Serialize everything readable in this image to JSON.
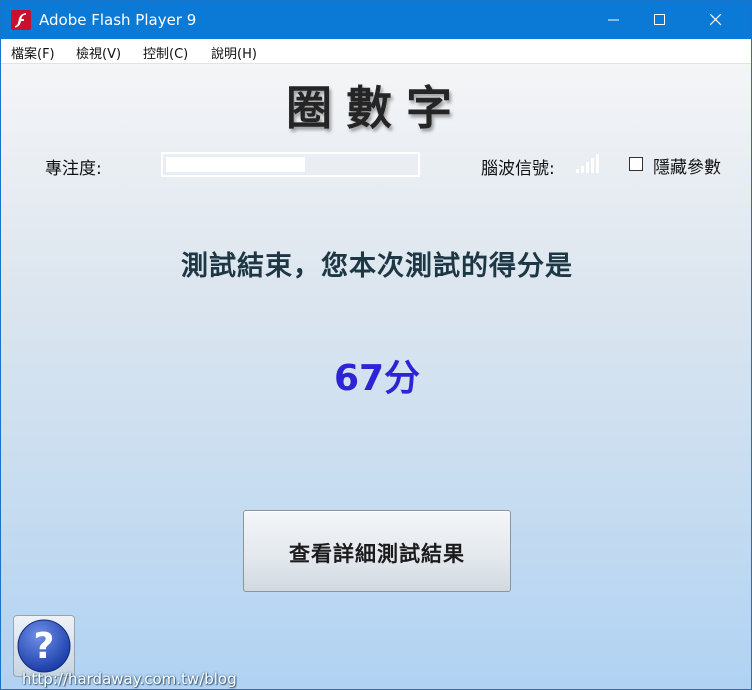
{
  "window": {
    "title": "Adobe Flash Player 9",
    "accent_color": "#0a7ad6",
    "icons": [
      "flash-icon",
      "minimize-icon",
      "maximize-icon",
      "close-icon"
    ]
  },
  "menu": {
    "items": [
      {
        "label": "檔案(F)"
      },
      {
        "label": "檢視(V)"
      },
      {
        "label": "控制(C)"
      },
      {
        "label": "說明(H)"
      }
    ]
  },
  "app": {
    "title": "圈數字",
    "focus": {
      "label": "專注度:",
      "level": 0.56
    },
    "signal": {
      "label": "腦波信號:",
      "icon": "signal-bars-icon",
      "bars": 5
    },
    "hide_params": {
      "label": "隱藏參數",
      "checked": false
    },
    "result_message": "測試結束，您本次測試的得分是",
    "score": "67分",
    "score_color": "#2f23d6",
    "detail_button": "查看詳細測試結果",
    "help_icon": "question-mark-icon"
  },
  "watermark": "http://hardaway.com.tw/blog"
}
